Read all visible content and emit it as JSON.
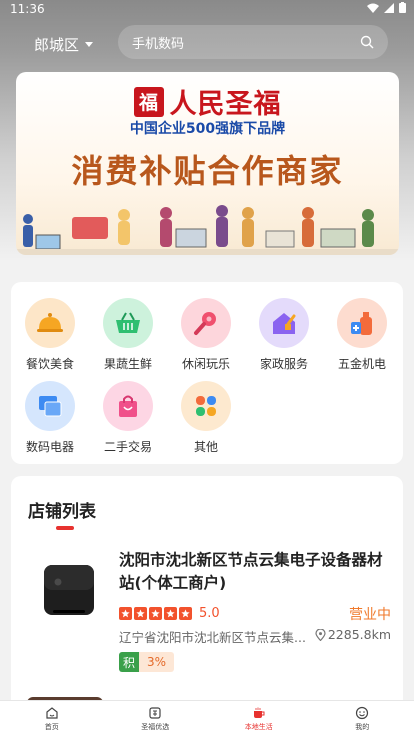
{
  "status_bar": {
    "time": "11:36"
  },
  "header": {
    "location": "郎城区",
    "search_placeholder": "手机数码"
  },
  "banner": {
    "seal_char": "福",
    "brand": "人民圣福",
    "subtitle": "中国企业500强旗下品牌",
    "headline": "消费补贴合作商家"
  },
  "categories": [
    {
      "label": "餐饮美食",
      "icon": "food-cloche-icon",
      "color": "#f6a623"
    },
    {
      "label": "果蔬生鲜",
      "icon": "basket-icon",
      "color": "#2fbf71"
    },
    {
      "label": "休闲玩乐",
      "icon": "microphone-icon",
      "color": "#f0506e"
    },
    {
      "label": "家政服务",
      "icon": "house-icon",
      "color": "#8a63f0"
    },
    {
      "label": "五金机电",
      "icon": "spray-bottle-icon",
      "color": "#f36b3b"
    },
    {
      "label": "数码电器",
      "icon": "devices-icon",
      "color": "#3d8bf2"
    },
    {
      "label": "二手交易",
      "icon": "shopping-bag-icon",
      "color": "#f0508a"
    },
    {
      "label": "其他",
      "icon": "grid-icon",
      "color": "#f5a623"
    }
  ],
  "store_section": {
    "title": "店铺列表",
    "items": [
      {
        "name": "沈阳市沈北新区节点云集电子设备器材站(个体工商户)",
        "score": "5.0",
        "status": "营业中",
        "address": "辽宁省沈阳市沈北新区节点云集...",
        "distance": "2285.8km",
        "tag_key": "积",
        "tag_value": "3%",
        "stars": 5
      }
    ]
  },
  "bottom_nav": [
    {
      "label": "首页",
      "icon": "home-icon",
      "active": false
    },
    {
      "label": "圣福优选",
      "icon": "fu-icon",
      "active": false
    },
    {
      "label": "本地生活",
      "icon": "coffee-icon",
      "active": true
    },
    {
      "label": "我的",
      "icon": "smile-icon",
      "active": false
    }
  ],
  "colors": {
    "accent": "#e7322f",
    "open_status": "#f07a2c",
    "brand_red": "#c8161d"
  }
}
